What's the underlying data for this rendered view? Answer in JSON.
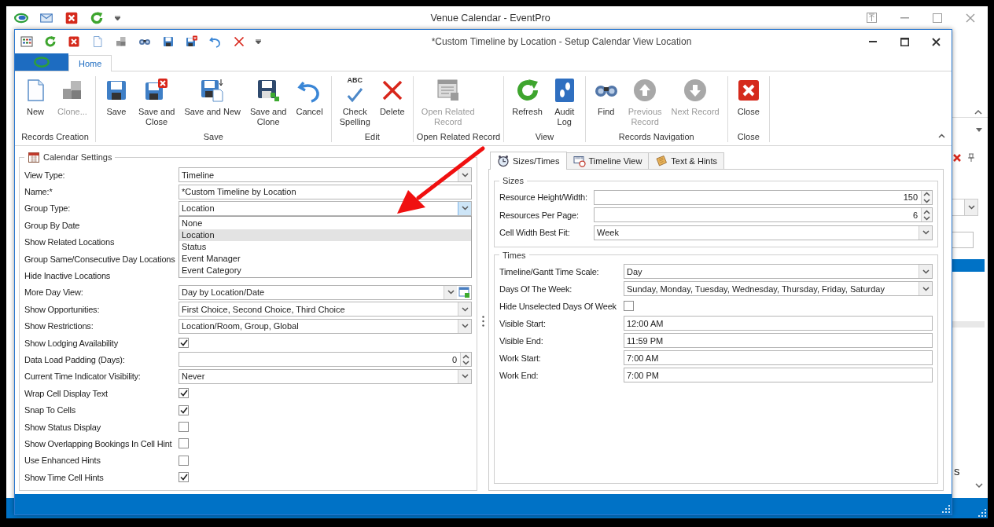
{
  "app_window": {
    "title": "Venue Calendar - EventPro",
    "background_text": "s"
  },
  "dialog": {
    "title": "*Custom Timeline by Location - Setup Calendar View Location",
    "ribbon_tabs": [
      {
        "label": "Home",
        "selected": true
      }
    ],
    "ribbon_groups": [
      {
        "label": "Records Creation",
        "buttons": [
          {
            "label": "New",
            "disabled": false
          },
          {
            "label": "Clone...",
            "disabled": true
          }
        ]
      },
      {
        "label": "Save",
        "buttons": [
          {
            "label": "Save",
            "disabled": false
          },
          {
            "label": "Save and\nClose",
            "disabled": false
          },
          {
            "label": "Save and New",
            "disabled": false
          },
          {
            "label": "Save and\nClone",
            "disabled": false
          },
          {
            "label": "Cancel",
            "disabled": false
          }
        ]
      },
      {
        "label": "Edit",
        "buttons": [
          {
            "label": "Check\nSpelling",
            "badge": "ABC",
            "disabled": false
          },
          {
            "label": "Delete",
            "disabled": false
          }
        ]
      },
      {
        "label": "Open Related Record",
        "buttons": [
          {
            "label": "Open Related\nRecord",
            "disabled": true
          }
        ]
      },
      {
        "label": "View",
        "buttons": [
          {
            "label": "Refresh",
            "disabled": false
          },
          {
            "label": "Audit\nLog",
            "disabled": false
          }
        ]
      },
      {
        "label": "Records Navigation",
        "buttons": [
          {
            "label": "Find",
            "disabled": false
          },
          {
            "label": "Previous\nRecord",
            "disabled": true
          },
          {
            "label": "Next Record",
            "disabled": true
          }
        ]
      },
      {
        "label": "Close",
        "buttons": [
          {
            "label": "Close",
            "disabled": false
          }
        ]
      }
    ]
  },
  "calendar_settings": {
    "title": "Calendar Settings",
    "rows": [
      {
        "kind": "combo",
        "label": "View Type:",
        "value": "Timeline",
        "open": false
      },
      {
        "kind": "text",
        "label": "Name:*",
        "value": "*Custom Timeline by Location"
      },
      {
        "kind": "combo",
        "label": "Group Type:",
        "value": "Location",
        "open": true,
        "options": [
          {
            "label": "None",
            "selected": false
          },
          {
            "label": "Location",
            "selected": true
          },
          {
            "label": "Status",
            "selected": false
          },
          {
            "label": "Event Manager",
            "selected": false
          },
          {
            "label": "Event Category",
            "selected": false
          }
        ]
      },
      {
        "kind": "label",
        "label": "Group By Date"
      },
      {
        "kind": "label",
        "label": "Show Related Locations"
      },
      {
        "kind": "label",
        "label": "Group Same/Consecutive Day Locations"
      },
      {
        "kind": "label",
        "label": "Hide Inactive Locations"
      },
      {
        "kind": "combo-extra",
        "label": "More Day View:",
        "value": "Day by Location/Date",
        "open": false
      },
      {
        "kind": "combo",
        "label": "Show Opportunities:",
        "value": "First Choice, Second Choice, Third Choice",
        "open": false
      },
      {
        "kind": "combo",
        "label": "Show Restrictions:",
        "value": "Location/Room, Group, Global",
        "open": false
      },
      {
        "kind": "check",
        "label": "Show Lodging Availability",
        "checked": true
      },
      {
        "kind": "spin",
        "label": "Data Load Padding (Days):",
        "value": "0"
      },
      {
        "kind": "combo",
        "label": "Current Time Indicator Visibility:",
        "value": "Never",
        "open": false
      },
      {
        "kind": "check",
        "label": "Wrap Cell Display Text",
        "checked": true
      },
      {
        "kind": "check",
        "label": "Snap To Cells",
        "checked": true
      },
      {
        "kind": "check",
        "label": "Show Status Display",
        "checked": false
      },
      {
        "kind": "check",
        "label": "Show Overlapping Bookings In Cell Hint",
        "checked": false
      },
      {
        "kind": "check",
        "label": "Use Enhanced Hints",
        "checked": false
      },
      {
        "kind": "check",
        "label": "Show Time Cell Hints",
        "checked": true
      }
    ]
  },
  "settings_tabs": [
    {
      "label": "Sizes/Times",
      "selected": true
    },
    {
      "label": "Timeline View",
      "selected": false
    },
    {
      "label": "Text & Hints",
      "selected": false
    }
  ],
  "sizes": {
    "title": "Sizes",
    "rows": [
      {
        "kind": "spin",
        "label": "Resource Height/Width:",
        "value": "150"
      },
      {
        "kind": "spin",
        "label": "Resources Per Page:",
        "value": "6"
      },
      {
        "kind": "combo",
        "label": "Cell Width Best Fit:",
        "value": "Week",
        "open": false
      }
    ]
  },
  "times": {
    "title": "Times",
    "rows": [
      {
        "kind": "combo",
        "label": "Timeline/Gantt Time Scale:",
        "value": "Day",
        "open": false
      },
      {
        "kind": "combo",
        "label": "Days Of The Week:",
        "value": "Sunday, Monday, Tuesday, Wednesday, Thursday, Friday, Saturday",
        "open": false
      },
      {
        "kind": "check",
        "label": "Hide Unselected Days Of Week",
        "checked": false
      },
      {
        "kind": "text",
        "label": "Visible Start:",
        "value": "12:00 AM"
      },
      {
        "kind": "text",
        "label": "Visible End:",
        "value": "11:59 PM"
      },
      {
        "kind": "text",
        "label": "Work Start:",
        "value": "7:00 AM"
      },
      {
        "kind": "text",
        "label": "Work End:",
        "value": "7:00 PM"
      }
    ]
  }
}
